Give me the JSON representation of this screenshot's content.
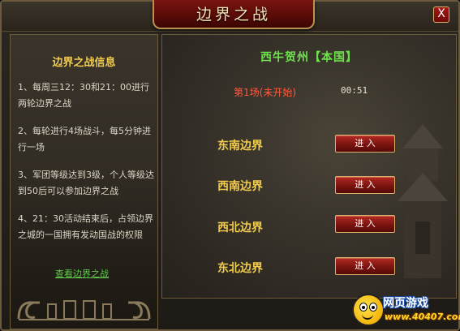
{
  "window": {
    "title": "边界之战",
    "close_label": "X"
  },
  "info": {
    "title": "边界之战信息",
    "items": [
      "1、每周三12：30和21：00进行两轮边界之战",
      "2、每轮进行4场战斗，每5分钟进行一场",
      "3、军团等级达到3级，个人等级达到50后可以参加边界之战",
      "4、21：30活动结束后，占领边界之城的一国拥有发动国战的权限"
    ],
    "link": "查看边界之战"
  },
  "battle": {
    "nation": "西牛贺州【本国】",
    "round_status": "第1场(未开始)",
    "timer": "00:51",
    "borders": [
      {
        "name": "东南边界",
        "button": "进 入"
      },
      {
        "name": "西南边界",
        "button": "进 入"
      },
      {
        "name": "西北边界",
        "button": "进 入"
      },
      {
        "name": "东北边界",
        "button": "进 入"
      }
    ]
  },
  "watermark": {
    "line1": "网页游戏",
    "line2": "www.40407.com"
  }
}
